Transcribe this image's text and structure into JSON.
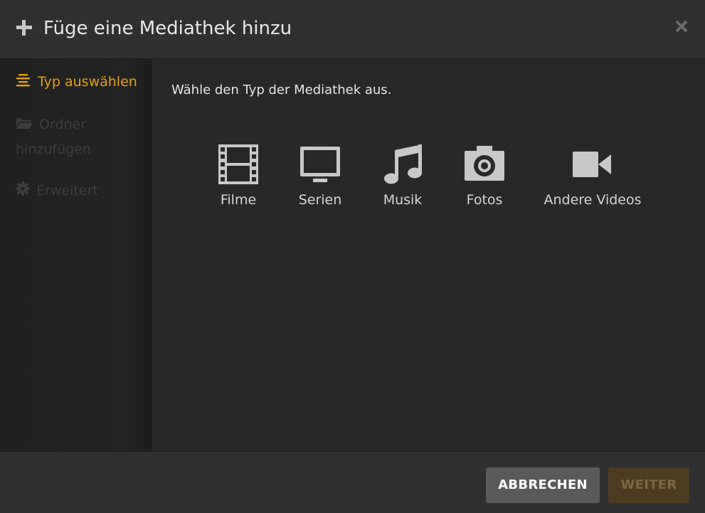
{
  "dialog": {
    "title": "Füge eine Mediathek hinzu",
    "icons": {
      "add": "plus-icon",
      "close": "close-icon"
    }
  },
  "sidebar": {
    "items": [
      {
        "label": "Typ auswählen",
        "icon": "list-icon",
        "state": "active"
      },
      {
        "label": "Ordner hinzufügen",
        "icon": "folder-open-icon",
        "state": "disabled"
      },
      {
        "label": "Erweitert",
        "icon": "gear-icon",
        "state": "disabled"
      }
    ]
  },
  "main": {
    "instruction": "Wähle den Typ der Mediathek aus.",
    "types": [
      {
        "label": "Filme",
        "icon": "film-icon"
      },
      {
        "label": "Serien",
        "icon": "tv-icon"
      },
      {
        "label": "Musik",
        "icon": "music-note-icon"
      },
      {
        "label": "Fotos",
        "icon": "camera-icon"
      },
      {
        "label": "Andere Videos",
        "icon": "video-camera-icon"
      }
    ]
  },
  "footer": {
    "cancel_label": "ABBRECHEN",
    "next_label": "WEITER"
  },
  "colors": {
    "accent": "#e5a00d",
    "background": "#282828",
    "header": "#303030",
    "sidebar": "#222222",
    "icon": "#c8c8c8",
    "disabled_text": "#3d3d3d",
    "cancel_button": "#5a5a5a",
    "next_button": "#4e3c20"
  }
}
